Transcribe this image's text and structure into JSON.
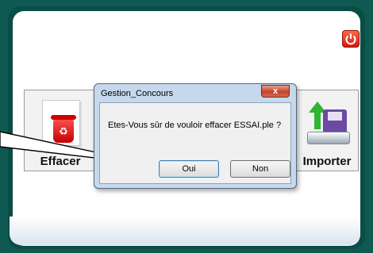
{
  "toolbar": {
    "effacer_label": "Effacer",
    "importer_label": "Importer"
  },
  "dialog": {
    "title": "Gestion_Concours",
    "message": "Etes-Vous sûr de vouloir effacer ESSAI.ple ?",
    "yes_label": "Oui",
    "no_label": "Non",
    "close_symbol": "x"
  },
  "icons": {
    "power": "power-icon",
    "recycle_bin": "recycle-bin-icon",
    "import": "import-disk-icon"
  },
  "colors": {
    "background": "#0e5a52",
    "panel": "#ffffff",
    "dialog_frame": "#c5d8ec",
    "power_button": "#d41b0b"
  }
}
